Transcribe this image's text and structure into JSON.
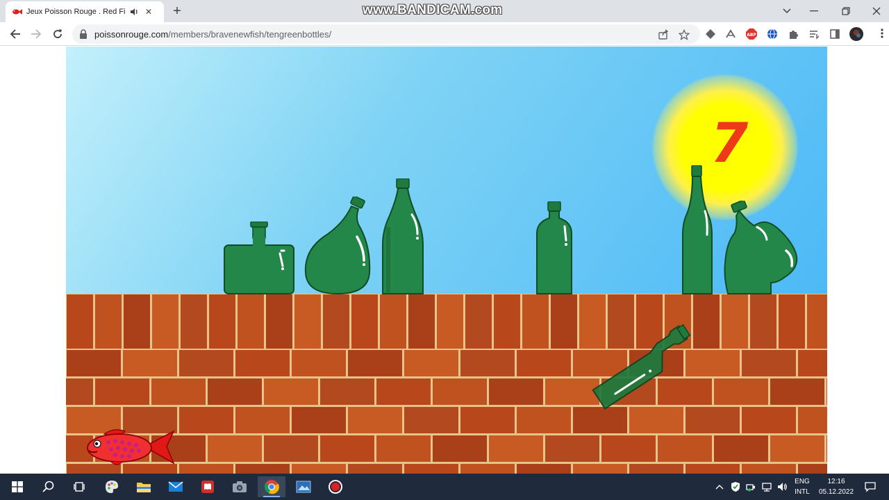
{
  "browser": {
    "tab": {
      "title": "Jeux Poisson Rouge . Red Fis"
    },
    "watermark": "www.BANDICAM.com",
    "url": {
      "host": "poissonrouge.com",
      "path": "/members/bravenewfish/tengreenbottles/"
    }
  },
  "game": {
    "counter": "7"
  },
  "taskbar": {
    "language": {
      "line1": "ENG",
      "line2": "INTL"
    },
    "clock": {
      "time": "12:16",
      "date": "05.12.2022"
    }
  },
  "colors": {
    "sky_light": "#c3f0fb",
    "sky_dark": "#4cb9f6",
    "sun": "#ffff00",
    "counter": "#ef3a1a",
    "bottle_green": "#23874a",
    "brick": "#b8471c",
    "mortar": "#e7c48a",
    "taskbar": "#1f2a3d"
  }
}
